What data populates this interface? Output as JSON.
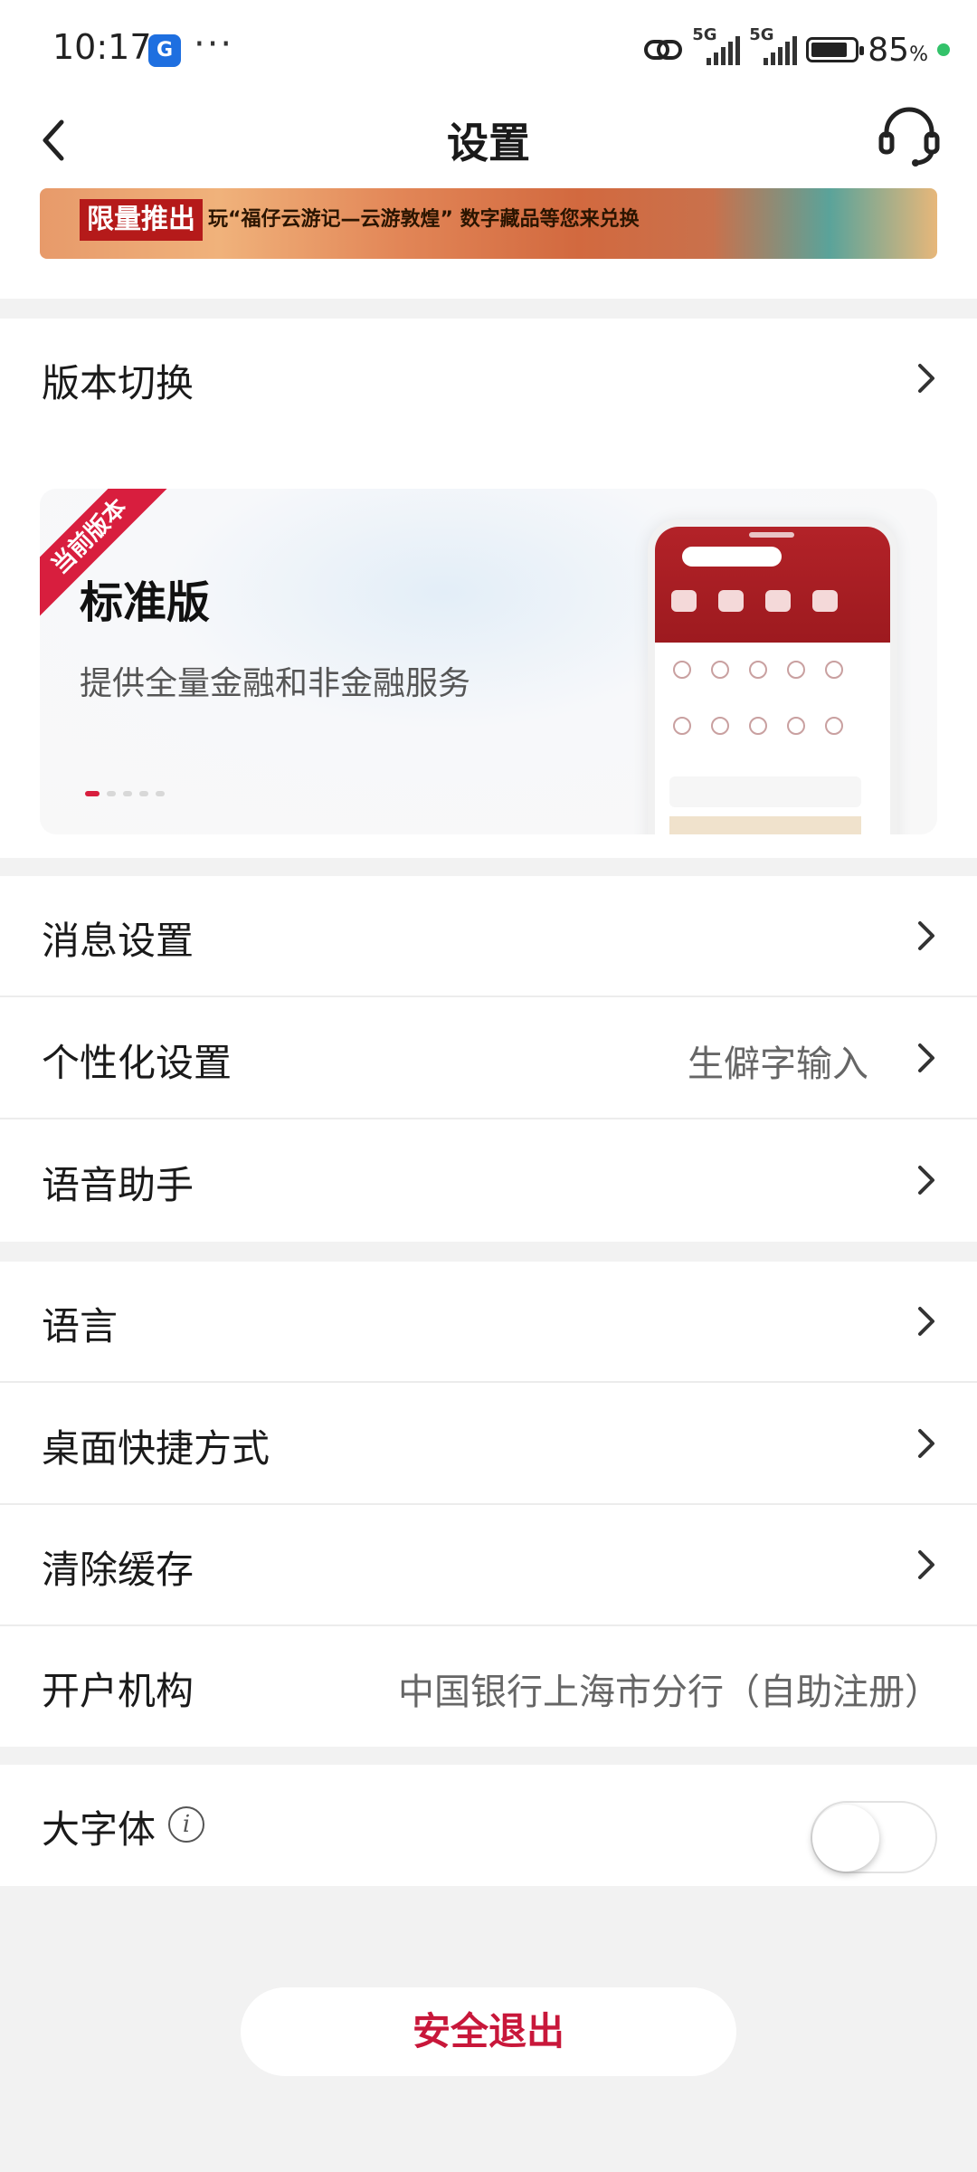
{
  "status_bar": {
    "time": "10:17",
    "app_icon_text": "G",
    "more": "···",
    "sim1": "5G",
    "sim2": "5G",
    "battery_level": 0.85,
    "battery_text": "85",
    "battery_unit": "%"
  },
  "header": {
    "title": "设置",
    "banner_tag": "限量推出",
    "banner_text": "玩“福仔云游记—云游敦煌” 数字藏品等您来兑换"
  },
  "version": {
    "row_label": "版本切换",
    "ribbon": "当前版本",
    "name": "标准版",
    "description": "提供全量金融和非金融服务",
    "page_count": 5,
    "active_page": 1
  },
  "rows": {
    "message": {
      "label": "消息设置"
    },
    "personalize": {
      "label": "个性化设置",
      "value": "生僻字输入"
    },
    "voice": {
      "label": "语音助手"
    },
    "language": {
      "label": "语言"
    },
    "shortcut": {
      "label": "桌面快捷方式"
    },
    "cache": {
      "label": "清除缓存"
    },
    "branch": {
      "label": "开户机构",
      "value": "中国银行上海市分行（自助注册）"
    },
    "large_font": {
      "label": "大字体",
      "info_icon": "i",
      "enabled": false
    }
  },
  "logout": {
    "label": "安全退出"
  },
  "colors": {
    "accent": "#c8173a",
    "ribbon": "#d81e3e",
    "background": "#f2f2f2"
  }
}
